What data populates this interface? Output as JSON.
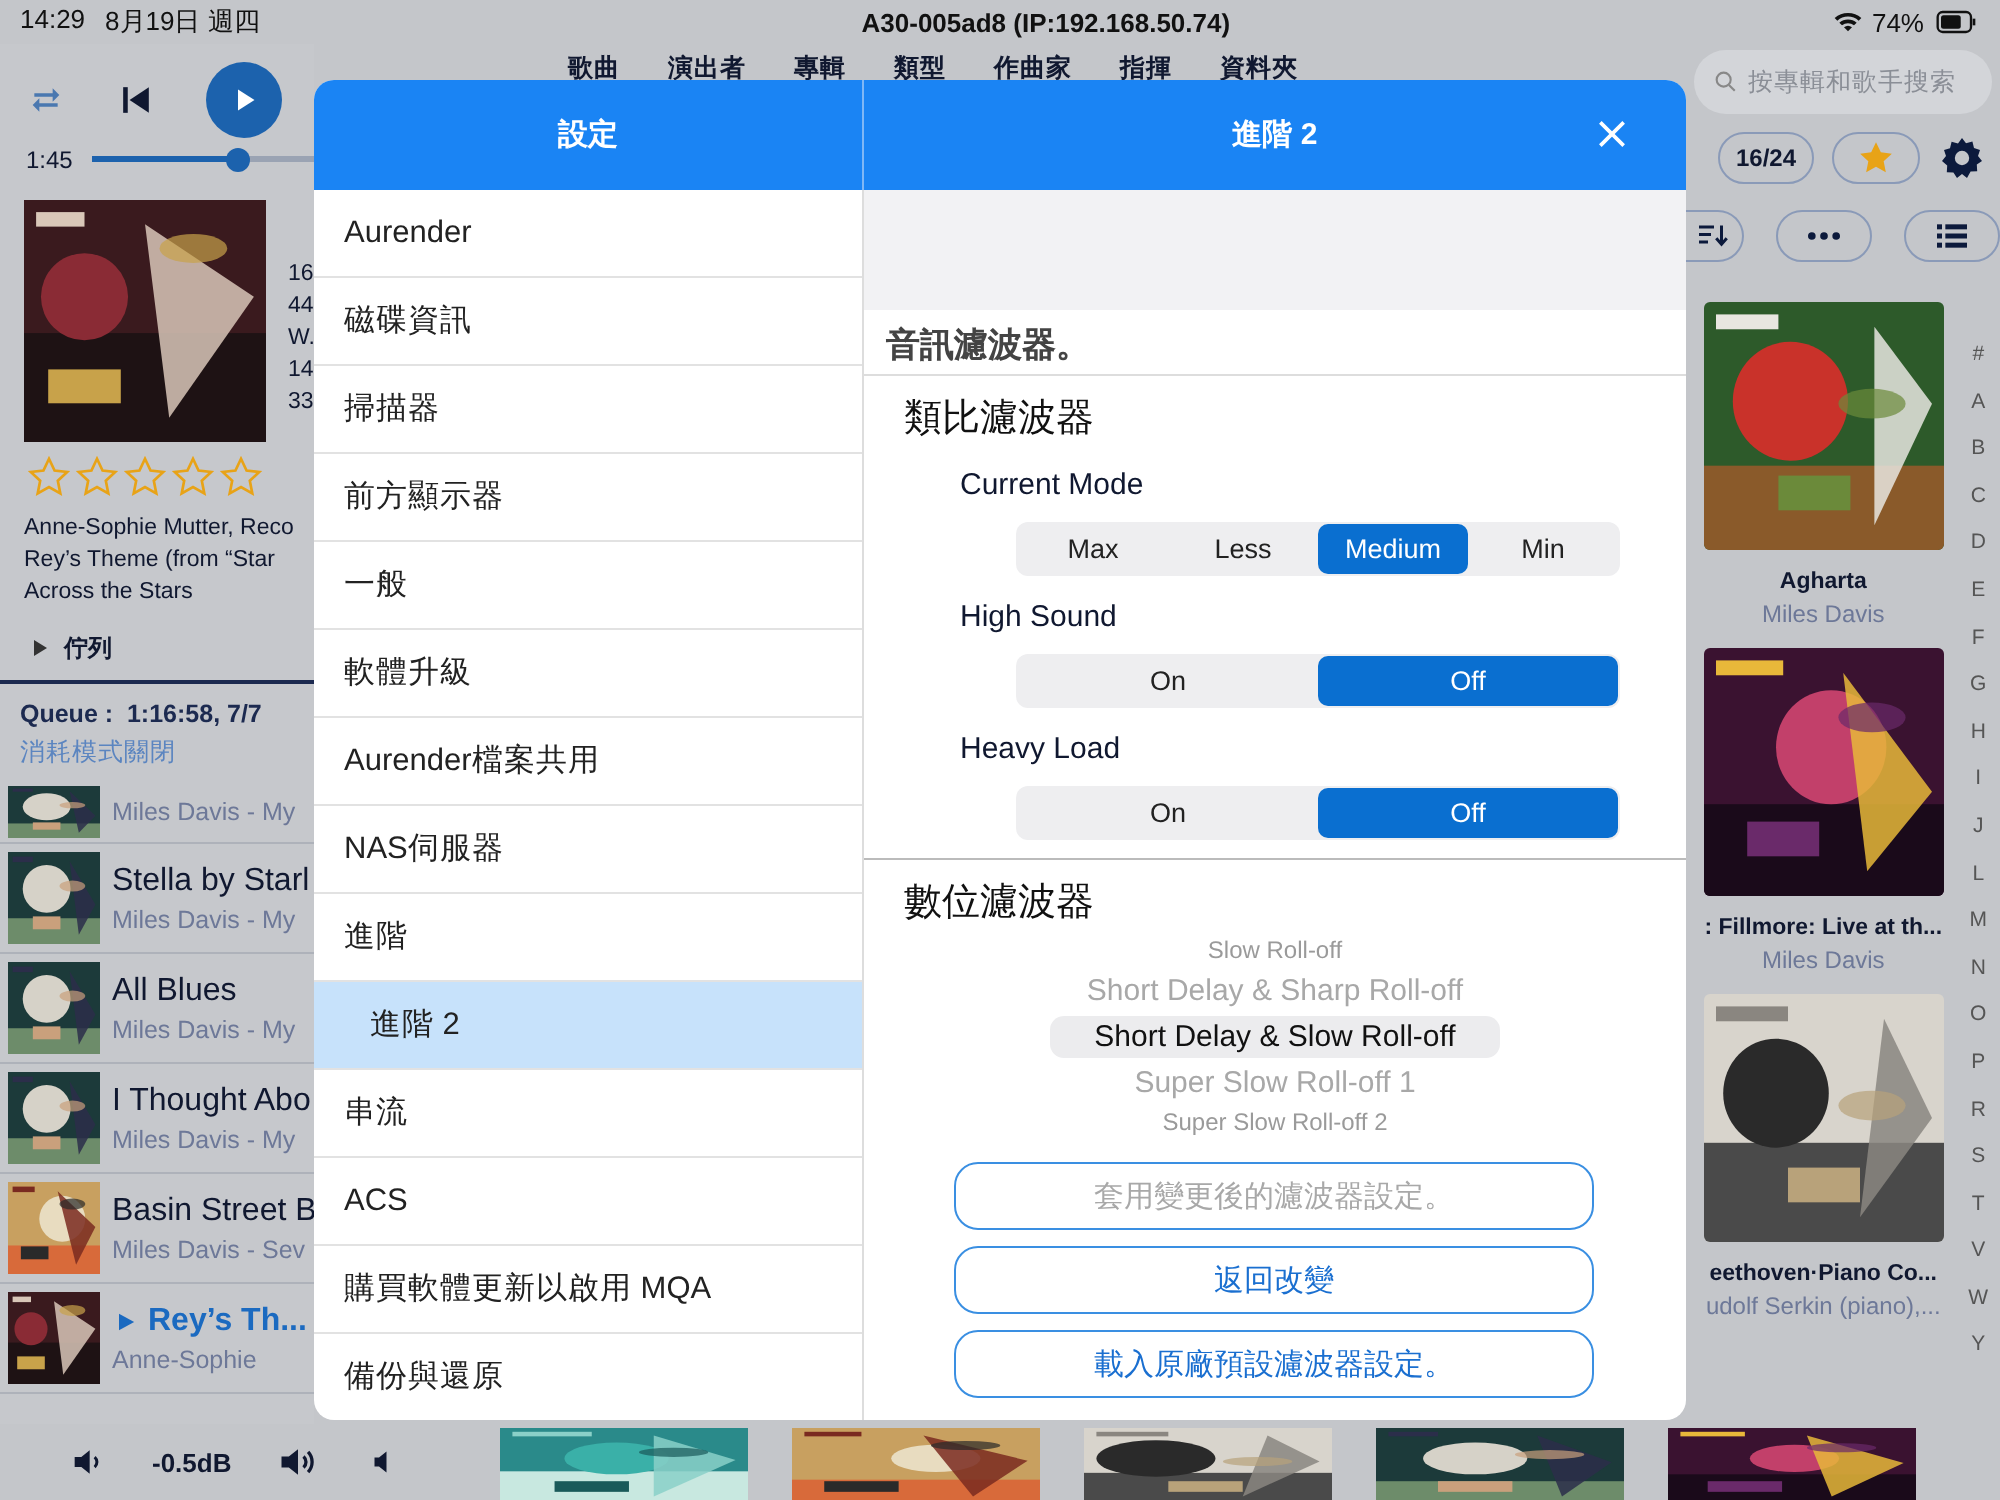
{
  "status_bar": {
    "time": "14:29",
    "date": "8月19日 週四",
    "device": "A30-005ad8 (IP:192.168.50.74)",
    "battery": "74%"
  },
  "player": {
    "elapsed": "1:45",
    "level": 0.66
  },
  "tabs": [
    {
      "label": "歌曲"
    },
    {
      "label": "演出者"
    },
    {
      "label": "專輯"
    },
    {
      "label": "類型"
    },
    {
      "label": "作曲家"
    },
    {
      "label": "指揮"
    },
    {
      "label": "資料夾"
    }
  ],
  "search": {
    "placeholder": "按專輯和歌手搜索"
  },
  "now_playing": {
    "stars": 0,
    "info": [
      "16",
      "44",
      "W.",
      "14",
      "33"
    ],
    "lines": [
      "Anne-Sophie Mutter, Reco",
      "Rey’s Theme (from “Star",
      "Across the Stars"
    ]
  },
  "queue_toggle": {
    "label": "佇列"
  },
  "queue": {
    "summary": "Queue :  1:16:58, 7/7",
    "mode": "消耗模式關閉",
    "items": [
      {
        "artist": "Miles Davis - My",
        "playing": false
      },
      {
        "title": "Stella by Starl",
        "artist": "Miles Davis - My",
        "playing": false
      },
      {
        "title": "All Blues",
        "artist": "Miles Davis - My",
        "playing": false
      },
      {
        "title": "I Thought Abo",
        "artist": "Miles Davis - My",
        "playing": false
      },
      {
        "title": "Basin Street B",
        "artist": "Miles Davis - Sev",
        "playing": false
      },
      {
        "title": "Rey’s Th...",
        "artist": "Anne-Sophie",
        "playing": true
      }
    ]
  },
  "toolbar": {
    "counter": "16/24"
  },
  "albums": [
    {
      "title": "Agharta",
      "artist": "Miles Davis"
    },
    {
      "title": ": Fillmore: Live at th...",
      "artist": "Miles Davis"
    },
    {
      "title": "eethoven·Piano Co...",
      "artist": "udolf Serkin (piano),..."
    }
  ],
  "index_letters": [
    "#",
    "A",
    "B",
    "C",
    "D",
    "E",
    "F",
    "G",
    "H",
    "I",
    "J",
    "L",
    "M",
    "N",
    "O",
    "P",
    "R",
    "S",
    "T",
    "V",
    "W",
    "Y"
  ],
  "volume": {
    "reading": "-0.5dB"
  },
  "settings_dialog": {
    "title": "設定",
    "page_title": "進階 2",
    "menu": [
      {
        "label": "Aurender",
        "selected": false
      },
      {
        "label": "磁碟資訊",
        "selected": false
      },
      {
        "label": "掃描器",
        "selected": false
      },
      {
        "label": "前方顯示器",
        "selected": false
      },
      {
        "label": "一般",
        "selected": false
      },
      {
        "label": "軟體升級",
        "selected": false
      },
      {
        "label": "Aurender檔案共用",
        "selected": false
      },
      {
        "label": "NAS伺服器",
        "selected": false
      },
      {
        "label": "進階",
        "selected": false,
        "children": [
          {
            "label": "進階 2",
            "selected": true
          }
        ]
      },
      {
        "label": "串流",
        "selected": false
      },
      {
        "label": "ACS",
        "selected": false
      },
      {
        "label": "購買軟體更新以啟用 MQA",
        "selected": false
      },
      {
        "label": "備份與還原",
        "selected": false
      }
    ],
    "section_label": "音訊濾波器。",
    "analog": {
      "heading": "類比濾波器",
      "rows": [
        {
          "label": "Current Mode",
          "options": [
            {
              "label": "Max",
              "selected": false
            },
            {
              "label": "Less",
              "selected": false
            },
            {
              "label": "Medium",
              "selected": true
            },
            {
              "label": "Min",
              "selected": false
            }
          ]
        },
        {
          "label": "High Sound",
          "options": [
            {
              "label": "On",
              "selected": false
            },
            {
              "label": "Off",
              "selected": true
            }
          ]
        },
        {
          "label": "Heavy Load",
          "options": [
            {
              "label": "On",
              "selected": false
            },
            {
              "label": "Off",
              "selected": true
            }
          ]
        }
      ]
    },
    "digital": {
      "heading": "數位濾波器",
      "options": [
        {
          "label": "Slow Roll-off",
          "selected": false
        },
        {
          "label": "Short Delay & Sharp Roll-off",
          "selected": false
        },
        {
          "label": "Short Delay & Slow Roll-off",
          "selected": true
        },
        {
          "label": "Super Slow Roll-off 1",
          "selected": false
        },
        {
          "label": "Super Slow Roll-off 2",
          "selected": false
        }
      ]
    },
    "buttons": [
      {
        "label": "套用變更後的濾波器設定。",
        "disabled": true
      },
      {
        "label": "返回改變",
        "disabled": false
      },
      {
        "label": "載入原廠預設濾波器設定。",
        "disabled": false
      }
    ]
  }
}
